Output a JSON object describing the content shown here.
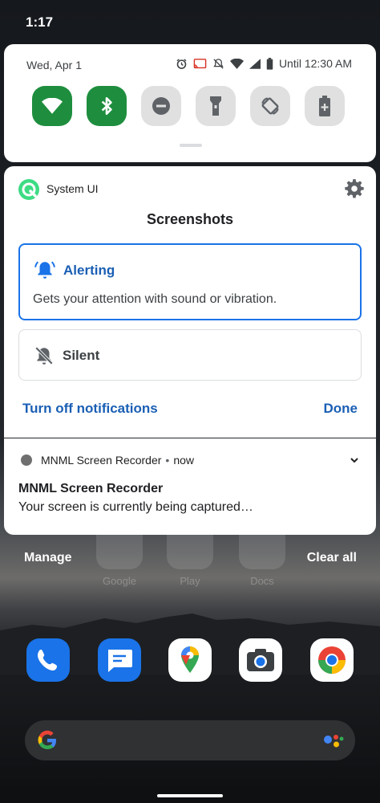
{
  "status_bar": {
    "time": "1:17"
  },
  "quick_settings": {
    "date": "Wed, Apr 1",
    "battery_text": "Until 12:30 AM",
    "tiles": [
      {
        "name": "wifi",
        "state": "on"
      },
      {
        "name": "bluetooth",
        "state": "on"
      },
      {
        "name": "do-not-disturb",
        "state": "off"
      },
      {
        "name": "flashlight",
        "state": "off"
      },
      {
        "name": "auto-rotate",
        "state": "off"
      },
      {
        "name": "battery-saver",
        "state": "off"
      }
    ]
  },
  "notification_settings": {
    "app_name": "System UI",
    "channel_title": "Screenshots",
    "alerting": {
      "label": "Alerting",
      "description": "Gets your attention with sound or vibration."
    },
    "silent": {
      "label": "Silent"
    },
    "turn_off_label": "Turn off notifications",
    "done_label": "Done"
  },
  "recorder_notification": {
    "app_name": "MNML Screen Recorder",
    "separator": "•",
    "time": "now",
    "title": "MNML Screen Recorder",
    "body": "Your screen is currently being captured…"
  },
  "footer": {
    "manage_label": "Manage",
    "clear_all_label": "Clear all"
  },
  "home": {
    "folders": [
      "Google",
      "Play",
      "Docs"
    ],
    "dock": [
      "phone",
      "messages",
      "maps",
      "camera",
      "chrome"
    ]
  },
  "colors": {
    "accent": "#1a73e8",
    "tile_on": "#1e8e3e",
    "tile_off": "#e0e0e0"
  }
}
